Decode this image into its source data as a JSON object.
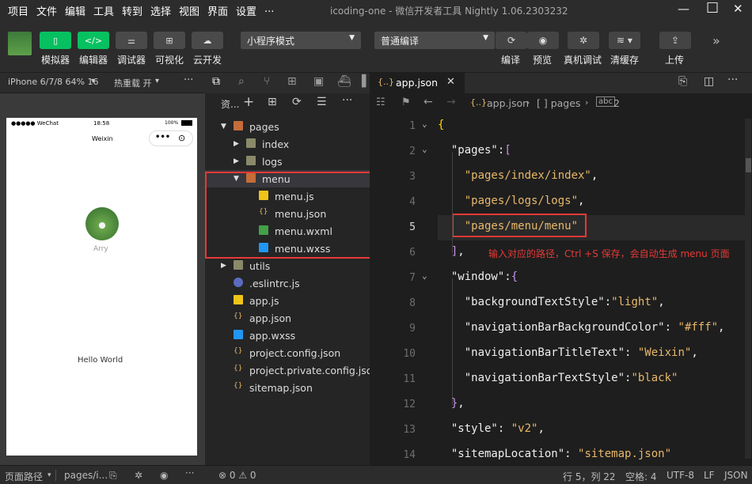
{
  "menubar": {
    "items": [
      "项目",
      "文件",
      "编辑",
      "工具",
      "转到",
      "选择",
      "视图",
      "界面",
      "设置",
      "..."
    ],
    "title": "icoding-one - 微信开发者工具 Nightly 1.06.2303232"
  },
  "toolbar": {
    "buttons": [
      {
        "label": "模拟器"
      },
      {
        "label": "编辑器"
      },
      {
        "label": "调试器"
      },
      {
        "label": "可视化"
      },
      {
        "label": "云开发"
      }
    ],
    "mode_select": "小程序模式",
    "compile_select": "普通编译",
    "actions": [
      {
        "label": "编译"
      },
      {
        "label": "预览"
      },
      {
        "label": "真机调试"
      },
      {
        "label": "清缓存"
      },
      {
        "label": "上传"
      }
    ]
  },
  "simulator": {
    "device": "iPhone 6/7/8 64% 16",
    "hotreload": "热重载 开",
    "status_carrier": "●●●●● WeChat",
    "status_time": "18:58",
    "status_battery": "100%",
    "nav_title": "Weixin",
    "user_name": "Arry",
    "hello": "Hello World"
  },
  "explorer": {
    "header": "资..."
  },
  "tree": [
    {
      "label": "pages",
      "depth": 0,
      "type": "folder-open"
    },
    {
      "label": "index",
      "depth": 1,
      "type": "folder"
    },
    {
      "label": "logs",
      "depth": 1,
      "type": "folder"
    },
    {
      "label": "menu",
      "depth": 1,
      "type": "folder-open"
    },
    {
      "label": "menu.js",
      "depth": 2,
      "type": "js"
    },
    {
      "label": "menu.json",
      "depth": 2,
      "type": "json"
    },
    {
      "label": "menu.wxml",
      "depth": 2,
      "type": "wxml"
    },
    {
      "label": "menu.wxss",
      "depth": 2,
      "type": "wxss"
    },
    {
      "label": "utils",
      "depth": 0,
      "type": "folder"
    },
    {
      "label": ".eslintrc.js",
      "depth": 0,
      "type": "eslint"
    },
    {
      "label": "app.js",
      "depth": 0,
      "type": "js"
    },
    {
      "label": "app.json",
      "depth": 0,
      "type": "json"
    },
    {
      "label": "app.wxss",
      "depth": 0,
      "type": "wxss"
    },
    {
      "label": "project.config.json",
      "depth": 0,
      "type": "json"
    },
    {
      "label": "project.private.config.json",
      "depth": 0,
      "type": "json"
    },
    {
      "label": "sitemap.json",
      "depth": 0,
      "type": "json"
    }
  ],
  "editor": {
    "tab": "app.json",
    "breadcrumb": [
      "app.json",
      "[ ] pages",
      "2"
    ],
    "annotation": "输入对应的路径，Ctrl +S 保存，会自动生成 menu 页面",
    "line_numbers": [
      "1",
      "2",
      "3",
      "4",
      "5",
      "6",
      "7",
      "8",
      "9",
      "10",
      "11",
      "12",
      "13",
      "14"
    ]
  },
  "status": {
    "left": "页面路径",
    "path": "pages/i...",
    "problems": "⊗ 0 ⚠ 0",
    "position": "行 5，列 22",
    "indent": "空格: 4",
    "encoding": "UTF-8",
    "eol": "LF",
    "lang": "JSON"
  }
}
